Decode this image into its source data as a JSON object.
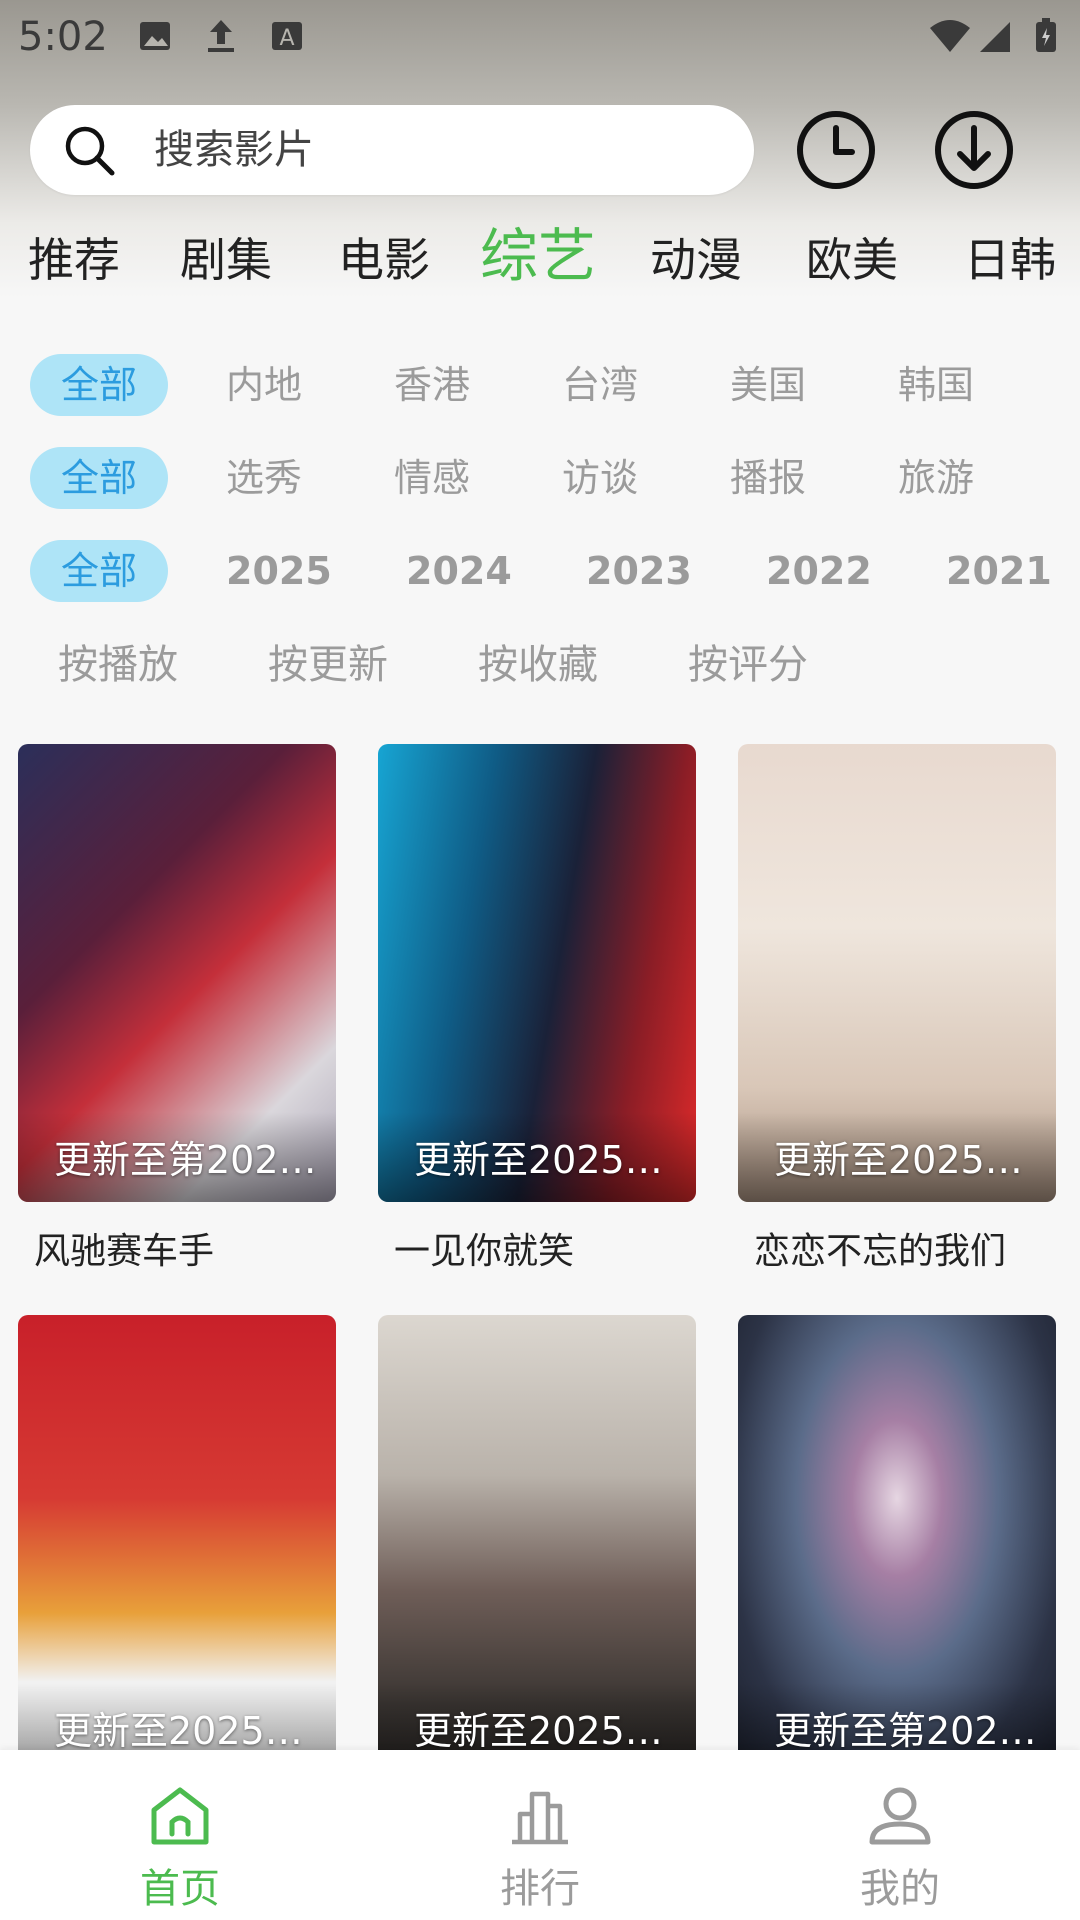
{
  "status_bar": {
    "time": "5:02"
  },
  "search": {
    "placeholder": "搜索影片"
  },
  "tabs": [
    "推荐",
    "剧集",
    "电影",
    "综艺",
    "动漫",
    "欧美",
    "日韩"
  ],
  "active_tab": "综艺",
  "filters": {
    "region": [
      "全部",
      "内地",
      "香港",
      "台湾",
      "美国",
      "韩国"
    ],
    "genre": [
      "全部",
      "选秀",
      "情感",
      "访谈",
      "播报",
      "旅游"
    ],
    "year": [
      "全部",
      "2025",
      "2024",
      "2023",
      "2022",
      "2021"
    ]
  },
  "sort_options": [
    "按播放",
    "按更新",
    "按收藏",
    "按评分"
  ],
  "cards": [
    {
      "update": "更新至第202…",
      "title": "风驰赛车手"
    },
    {
      "update": "更新至20250…",
      "title": "一见你就笑"
    },
    {
      "update": "更新至20250…",
      "title": "恋恋不忘的我们"
    },
    {
      "update": "更新至20250…",
      "title": ""
    },
    {
      "update": "更新至20250…",
      "title": ""
    },
    {
      "update": "更新至第202…",
      "title": ""
    }
  ],
  "bottom_nav": [
    "首页",
    "排行",
    "我的"
  ],
  "colors": {
    "accent": "#4cbb4f",
    "chip_bg": "#aee4f7",
    "chip_text": "#2c9cdf"
  }
}
